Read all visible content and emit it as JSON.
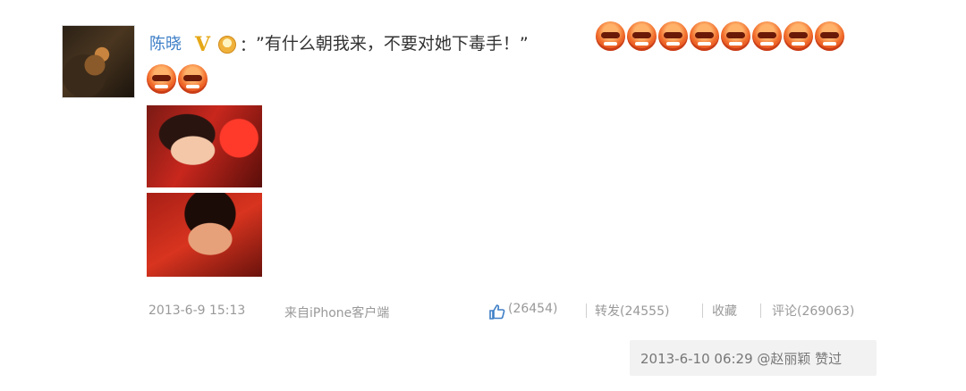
{
  "post": {
    "author": "陈晓",
    "verified_badge": "V",
    "colon": "：",
    "text": "”有什么朝我来，不要对她下毒手！”",
    "emoji_name": "angry-face",
    "emoji_count": 10
  },
  "meta": {
    "time": "2013-6-9 15:13",
    "source": "来自iPhone客户端"
  },
  "actions": {
    "like_count": "(26454)",
    "repost": "转发(24555)",
    "collect": "收藏",
    "comment": "评论(269063)"
  },
  "liked_note": "2013-6-10 06:29 @赵丽颖 赞过",
  "colors": {
    "name_link": "#3e7fc7",
    "muted": "#999999",
    "like_icon": "#3e7fc7"
  }
}
